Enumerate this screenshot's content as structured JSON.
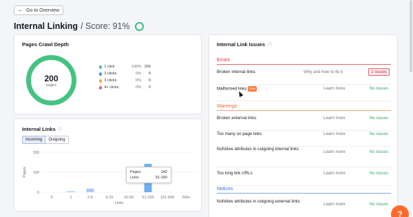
{
  "nav": {
    "back_label": "Go to Overview"
  },
  "header": {
    "title": "Internal Linking",
    "score_text": "/ Score: 91%",
    "score_color": "#3dbe82"
  },
  "crawl_depth": {
    "title": "Pages Crawl Depth",
    "total": "200",
    "total_label": "pages",
    "legend": [
      {
        "label": "1 click",
        "pct": "100%",
        "count": "200",
        "color": "#44c383"
      },
      {
        "label": "2 clicks",
        "pct": "0%",
        "count": "0",
        "color": "#4a90e2"
      },
      {
        "label": "3 clicks",
        "pct": "0%",
        "count": "0",
        "color": "#f0a33a"
      },
      {
        "label": "4+ clicks",
        "pct": "0%",
        "count": "0",
        "color": "#e6616c"
      }
    ]
  },
  "internal_links": {
    "title": "Internal Links",
    "tabs": [
      "Incoming",
      "Outgoing"
    ],
    "tooltip": {
      "pages_label": "Pages",
      "pages_value": "142",
      "links_label": "Links",
      "links_value": "51-150"
    }
  },
  "chart_data": {
    "type": "bar",
    "categories": [
      "0",
      "1",
      "2-5",
      "6-15",
      "16-50",
      "51-150",
      "151-500",
      "500+"
    ],
    "values": [
      0,
      5,
      18,
      0,
      0,
      142,
      0,
      0
    ],
    "xlabel": "Links",
    "ylabel": "Pages",
    "yticks": [
      "0",
      "100",
      "200"
    ],
    "ylim": [
      0,
      200
    ],
    "bar_color": "#a9cdf5",
    "highlight_color": "#6fb0f0"
  },
  "issues": {
    "title": "Internal Link Issues",
    "sections": {
      "errors": "Errors",
      "warnings": "Warnings",
      "notices": "Notices"
    },
    "error_rows": [
      {
        "name": "Broken internal links",
        "learn": "Why and how to fix it",
        "status": "2 issues"
      },
      {
        "name": "Malformed links",
        "beta": "beta",
        "learn": "Learn more",
        "status": "No issues"
      }
    ],
    "warning_rows": [
      {
        "name": "Broken external links",
        "learn": "Learn more",
        "status": "No issues"
      },
      {
        "name": "Too many on-page links",
        "learn": "Learn more",
        "status": "No issues"
      },
      {
        "name": "Nofollow attributes in outgoing internal links",
        "learn": "Learn more",
        "status": "No issues"
      },
      {
        "name": "Too long link URLs",
        "learn": "Learn more",
        "status": "No issues"
      }
    ],
    "notice_rows": [
      {
        "name": "Nofollow attributes in outgoing external links",
        "learn": "Learn more",
        "status": "No issues"
      }
    ]
  },
  "help": {
    "label": "?"
  }
}
